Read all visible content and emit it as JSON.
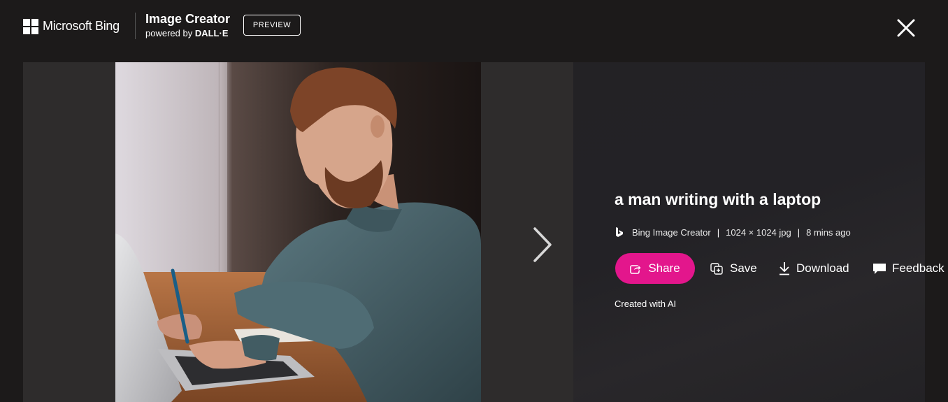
{
  "header": {
    "brand": "Microsoft Bing",
    "product_title": "Image Creator",
    "powered_by_prefix": "powered by",
    "powered_by_name": "DALL·E",
    "badge": "PREVIEW"
  },
  "image": {
    "alt": "a man writing with a laptop",
    "title": "a man writing with a laptop"
  },
  "meta": {
    "source": "Bing Image Creator",
    "separator": "|",
    "dimensions": "1024 × 1024 jpg",
    "age": "8 mins ago"
  },
  "actions": {
    "share": "Share",
    "save": "Save",
    "download": "Download",
    "feedback": "Feedback"
  },
  "footer_note": "Created with AI",
  "colors": {
    "background": "#1c1a1a",
    "accent": "#e3168c",
    "panel": "#232225"
  },
  "icons": [
    "microsoft-logo-icon",
    "close-icon",
    "chevron-right-icon",
    "bing-b-icon",
    "share-icon",
    "save-icon",
    "download-icon",
    "feedback-icon"
  ]
}
